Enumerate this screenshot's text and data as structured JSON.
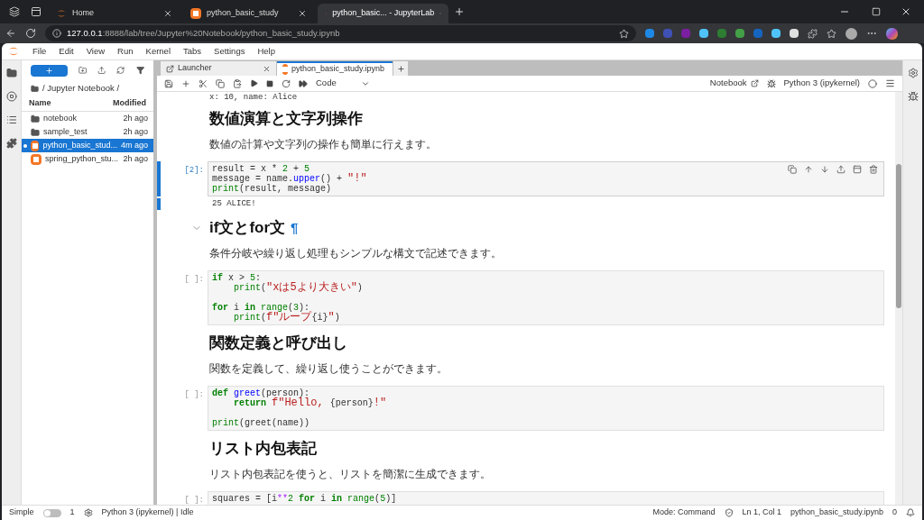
{
  "browser": {
    "tabs": [
      {
        "title": "Home",
        "kind": "jupyter",
        "selected": false
      },
      {
        "title": "python_basic_study",
        "kind": "notebook",
        "selected": false
      },
      {
        "title": "python_basic... - JupyterLab",
        "kind": "jupyter",
        "selected": true
      }
    ],
    "address": {
      "host": "127.0.0.1",
      "path": ":8888/lab/tree/Jupyter%20Notebook/python_basic_study.ipynb"
    }
  },
  "menu": [
    "File",
    "Edit",
    "View",
    "Run",
    "Kernel",
    "Tabs",
    "Settings",
    "Help"
  ],
  "file_browser": {
    "breadcrumb": "/ Jupyter Notebook /",
    "columns": [
      "Name",
      "Modified"
    ],
    "items": [
      {
        "name": "notebook",
        "modified": "2h ago",
        "kind": "folder",
        "selected": false,
        "running": false
      },
      {
        "name": "sample_test",
        "modified": "2h ago",
        "kind": "folder",
        "selected": false,
        "running": false
      },
      {
        "name": "python_basic_stud...",
        "modified": "4m ago",
        "kind": "notebook",
        "selected": true,
        "running": true
      },
      {
        "name": "spring_python_stu...",
        "modified": "2h ago",
        "kind": "notebook",
        "selected": false,
        "running": false
      }
    ]
  },
  "notebook": {
    "tabs": [
      {
        "title": "Launcher",
        "kind": "launcher",
        "selected": false
      },
      {
        "title": "python_basic_study.ipynb",
        "kind": "notebook",
        "selected": true
      }
    ],
    "cell_type": "Code",
    "view_label": "Notebook",
    "kernel": "Python 3 (ipykernel)",
    "cells": [
      {
        "kind": "output",
        "text": "x: 10, name: Alice"
      },
      {
        "kind": "heading",
        "text": "数値演算と文字列操作"
      },
      {
        "kind": "paragraph",
        "text": "数値の計算や文字列の操作も簡単に行えます。"
      },
      {
        "kind": "code",
        "prompt": "[2]:",
        "active": true,
        "output": "25 ALICE!",
        "blocks": [
          [
            {
              "tokens": [
                {
                  "t": "result = x * "
                },
                {
                  "t": "2",
                  "kind": "num"
                },
                {
                  "t": " + "
                },
                {
                  "t": "5",
                  "kind": "num"
                }
              ]
            },
            {
              "tokens": [
                {
                  "t": "message = name."
                },
                {
                  "t": "upper",
                  "kind": "fn"
                },
                {
                  "t": "() + "
                },
                {
                  "t": "\"!\"",
                  "kind": "str"
                }
              ]
            },
            {
              "tokens": [
                {
                  "t": "print",
                  "kind": "builtin"
                },
                {
                  "t": "(result, message)"
                }
              ]
            }
          ]
        ]
      },
      {
        "kind": "heading",
        "text": "if文とfor文",
        "anchor": "¶"
      },
      {
        "kind": "paragraph",
        "text": "条件分岐や繰り返し処理もシンプルな構文で記述できます。"
      },
      {
        "kind": "code",
        "prompt": "[ ]:",
        "active": false,
        "blocks": [
          [
            {
              "tokens": [
                {
                  "t": "if",
                  "kind": "kw"
                },
                {
                  "t": " x > "
                },
                {
                  "t": "5",
                  "kind": "num"
                },
                {
                  "t": ":"
                }
              ]
            },
            {
              "indented": true,
              "tokens": [
                {
                  "t": "print",
                  "kind": "builtin"
                },
                {
                  "t": "("
                },
                {
                  "t": "\"xは5より大きい\"",
                  "kind": "str"
                },
                {
                  "t": ")"
                }
              ]
            }
          ],
          [
            {
              "tokens": [
                {
                  "t": "for",
                  "kind": "kw"
                },
                {
                  "t": " i "
                },
                {
                  "t": "in ",
                  "kind": "kw"
                },
                {
                  "t": "range",
                  "kind": "builtin"
                },
                {
                  "t": "("
                },
                {
                  "t": "3",
                  "kind": "num"
                },
                {
                  "t": "):"
                }
              ]
            },
            {
              "indented": true,
              "tokens": [
                {
                  "t": "print",
                  "kind": "builtin"
                },
                {
                  "t": "("
                },
                {
                  "t": "f\"ループ",
                  "kind": "str"
                },
                {
                  "t": "{i}"
                },
                {
                  "t": "\"",
                  "kind": "str"
                },
                {
                  "t": ")"
                }
              ]
            }
          ]
        ]
      },
      {
        "kind": "heading",
        "text": "関数定義と呼び出し"
      },
      {
        "kind": "paragraph",
        "text": "関数を定義して、繰り返し使うことができます。"
      },
      {
        "kind": "code",
        "prompt": "[ ]:",
        "active": false,
        "blocks": [
          [
            {
              "tokens": [
                {
                  "t": "def ",
                  "kind": "kw"
                },
                {
                  "t": "greet",
                  "kind": "fn"
                },
                {
                  "t": "(person):"
                }
              ]
            },
            {
              "indented": true,
              "tokens": [
                {
                  "t": "return ",
                  "kind": "kw"
                },
                {
                  "t": "f\"Hello, ",
                  "kind": "str"
                },
                {
                  "t": "{person}"
                },
                {
                  "t": "!\"",
                  "kind": "str"
                }
              ]
            }
          ],
          [
            {
              "tokens": [
                {
                  "t": "print",
                  "kind": "builtin"
                },
                {
                  "t": "(greet(name))"
                }
              ]
            }
          ]
        ]
      },
      {
        "kind": "heading",
        "text": "リスト内包表記"
      },
      {
        "kind": "paragraph",
        "text": "リスト内包表記を使うと、リストを簡潔に生成できます。"
      },
      {
        "kind": "code",
        "prompt": "[ ]:",
        "active": false,
        "blocks": [
          [
            {
              "tokens": [
                {
                  "t": "squares = [i"
                },
                {
                  "t": "**",
                  "kind": "op"
                },
                {
                  "t": "2 ",
                  "kind": "num"
                },
                {
                  "t": "for",
                  "kind": "kw"
                },
                {
                  "t": " i "
                },
                {
                  "t": "in ",
                  "kind": "kw"
                },
                {
                  "t": "range",
                  "kind": "builtin"
                },
                {
                  "t": "("
                },
                {
                  "t": "5",
                  "kind": "num"
                },
                {
                  "t": ")]"
                }
              ]
            }
          ]
        ]
      }
    ]
  },
  "status_bar": {
    "simple_label": "Simple",
    "simple_on": false,
    "terminals": "1",
    "kernel_status": "Python 3 (ipykernel) | Idle",
    "mode": "Mode: Command",
    "position": "Ln 1, Col 1",
    "file": "python_basic_study.ipynb",
    "notifications": "0"
  }
}
